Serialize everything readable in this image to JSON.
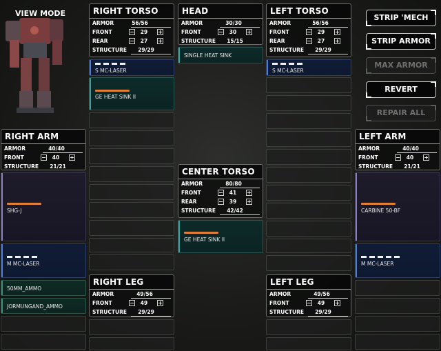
{
  "view_mode_label": "VIEW MODE",
  "buttons": {
    "strip_mech": "STRIP 'MECH",
    "strip_armor": "STRIP ARMOR",
    "max_armor": "MAX ARMOR",
    "revert": "REVERT",
    "repair_all": "REPAIR ALL"
  },
  "labels": {
    "armor": "ARMOR",
    "front": "FRONT",
    "rear": "REAR",
    "structure": "STRUCTURE"
  },
  "right_torso": {
    "title": "RIGHT TORSO",
    "armor": "56/56",
    "front": "29",
    "rear": "27",
    "structure": "29/29",
    "slots": [
      "S MC-LASER",
      "GE HEAT SINK II"
    ]
  },
  "head": {
    "title": "HEAD",
    "armor": "30/30",
    "front": "30",
    "structure": "15/15",
    "slots": [
      "SINGLE HEAT SINK"
    ]
  },
  "left_torso": {
    "title": "LEFT TORSO",
    "armor": "56/56",
    "front": "29",
    "rear": "27",
    "structure": "29/29",
    "slots": [
      "S MC-LASER"
    ]
  },
  "center_torso": {
    "title": "CENTER TORSO",
    "armor": "80/80",
    "front": "41",
    "rear": "39",
    "structure": "42/42",
    "slots": [
      "GE HEAT SINK II"
    ]
  },
  "right_arm": {
    "title": "RIGHT ARM",
    "armor": "40/40",
    "front": "40",
    "structure": "21/21",
    "slots": [
      "SHG-J",
      "M MC-LASER",
      "50MM_AMMO",
      "JORMUNGAND_AMMO"
    ]
  },
  "left_arm": {
    "title": "LEFT ARM",
    "armor": "40/40",
    "front": "40",
    "structure": "21/21",
    "slots": [
      "CARBINE 50-BF",
      "M MC-LASER"
    ]
  },
  "right_leg": {
    "title": "RIGHT LEG",
    "armor": "49/56",
    "front": "49",
    "structure": "29/29"
  },
  "left_leg": {
    "title": "LEFT LEG",
    "armor": "49/56",
    "front": "49",
    "structure": "29/29"
  },
  "colors": {
    "weapon": "#4b7cd7",
    "heat_sink": "#3e9d99",
    "ammo": "#3a8d77",
    "heat_bar": "#e07f3a"
  }
}
